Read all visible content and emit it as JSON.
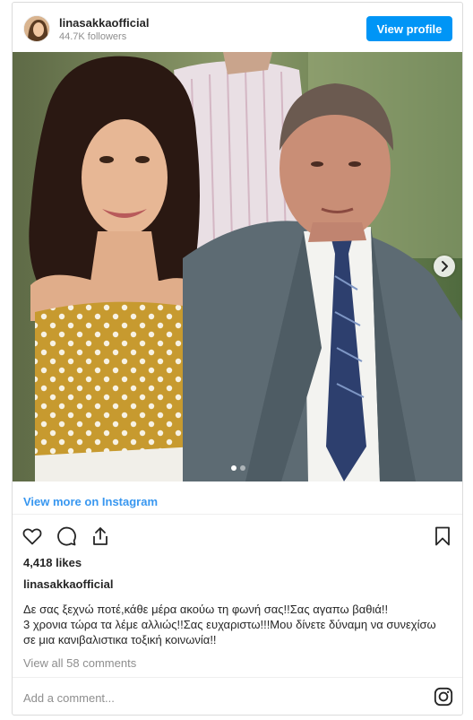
{
  "header": {
    "username": "linasakkaofficial",
    "followers": "44.7K followers",
    "view_profile_label": "View profile"
  },
  "post": {
    "image_count": 2,
    "active_image": 1,
    "view_more_label": "View more on Instagram",
    "likes": "4,418 likes",
    "caption_user": "linasakkaofficial",
    "caption_lines": [
      "Δε σας ξεχνώ ποτέ,κάθε μέρα ακούω τη φωνή σας!!Σας αγαπω βαθιά!!",
      "3 χρονια τώρα τα λέμε αλλιώς!!Σας ευχαριστω!!!Μου δίνετε δύναμη να συνεχίσω",
      "σε μια κανιβαλιστικα τοξική κοινωνία!!"
    ],
    "view_comments_label": "View all 58 comments",
    "add_comment_placeholder": "Add a comment..."
  },
  "icons": {
    "like": "heart-icon",
    "comment": "comment-icon",
    "share": "share-icon",
    "save": "bookmark-icon",
    "next": "chevron-right-icon",
    "brand": "instagram-icon"
  },
  "colors": {
    "accent": "#0095f6",
    "link": "#3897f0",
    "muted": "#8e8e8e"
  }
}
